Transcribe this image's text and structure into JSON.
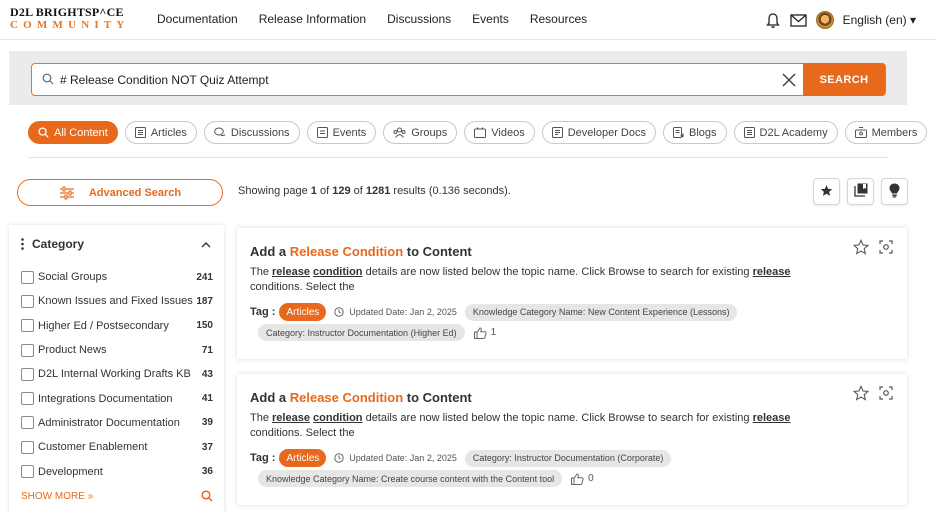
{
  "header": {
    "logo_line1": "D2L BRIGHTSP^CE",
    "logo_line2": "COMMUNITY",
    "nav": [
      "Documentation",
      "Release Information",
      "Discussions",
      "Events",
      "Resources"
    ],
    "language": "English (en) ▾"
  },
  "search": {
    "query": "# Release Condition NOT Quiz Attempt",
    "button_label": "SEARCH"
  },
  "tabs": [
    {
      "label": "All Content",
      "icon": "search-icon",
      "active": true
    },
    {
      "label": "Articles",
      "icon": "article-icon",
      "active": false
    },
    {
      "label": "Discussions",
      "icon": "discussion-icon",
      "active": false
    },
    {
      "label": "Events",
      "icon": "event-icon",
      "active": false
    },
    {
      "label": "Groups",
      "icon": "groups-icon",
      "active": false
    },
    {
      "label": "Videos",
      "icon": "video-icon",
      "active": false
    },
    {
      "label": "Developer Docs",
      "icon": "devdocs-icon",
      "active": false
    },
    {
      "label": "Blogs",
      "icon": "blog-icon",
      "active": false
    },
    {
      "label": "D2L Academy",
      "icon": "academy-icon",
      "active": false
    },
    {
      "label": "Members",
      "icon": "members-icon",
      "active": false
    }
  ],
  "advanced_search_label": "Advanced Search",
  "results": {
    "prefix": "Showing page ",
    "page": "1",
    "of1": " of ",
    "pages": "129",
    "of2": " of ",
    "total": "1281",
    "suffix": " results (0.136 seconds)."
  },
  "sidebar": {
    "title": "Category",
    "facets": [
      {
        "label": "Social Groups",
        "count": "241"
      },
      {
        "label": "Known Issues and Fixed Issues",
        "count": "187"
      },
      {
        "label": "Higher Ed / Postsecondary",
        "count": "150"
      },
      {
        "label": "Product News",
        "count": "71"
      },
      {
        "label": "D2L Internal Working Drafts KB",
        "count": "43"
      },
      {
        "label": "Integrations Documentation",
        "count": "41"
      },
      {
        "label": "Administrator Documentation",
        "count": "39"
      },
      {
        "label": "Customer Enablement",
        "count": "37"
      },
      {
        "label": "Development",
        "count": "36"
      }
    ],
    "show_more": "SHOW MORE »"
  },
  "cards": [
    {
      "title_pre": "Add a ",
      "title_hl": "Release Condition",
      "title_post": " to Content",
      "desc_pre": "The ",
      "desc_b1": "release",
      "desc_sp": " ",
      "desc_b2": "condition",
      "desc_mid": " details are now listed below the topic name. Click Browse to search for existing ",
      "desc_b3": "release",
      "desc_post": " conditions. Select the",
      "tag_label": "Tag :",
      "tag": "Articles",
      "updated": "Updated Date: Jan 2, 2025",
      "chip1": "Knowledge Category Name: New Content Experience (Lessons)",
      "chip2": "Category: Instructor Documentation (Higher Ed)",
      "likes": "1"
    },
    {
      "title_pre": "Add a ",
      "title_hl": "Release Condition",
      "title_post": " to Content",
      "desc_pre": "The ",
      "desc_b1": "release",
      "desc_sp": " ",
      "desc_b2": "condition",
      "desc_mid": " details are now listed below the topic name. Click Browse to search for existing ",
      "desc_b3": "release",
      "desc_post": " conditions. Select the",
      "tag_label": "Tag :",
      "tag": "Articles",
      "updated": "Updated Date: Jan 2, 2025",
      "chip1": "Category: Instructor Documentation (Corporate)",
      "chip2": "Knowledge Category Name: Create course content with the Content tool",
      "likes": "0"
    }
  ],
  "colors": {
    "accent": "#e8691c",
    "search_band": "#ebebeb"
  }
}
